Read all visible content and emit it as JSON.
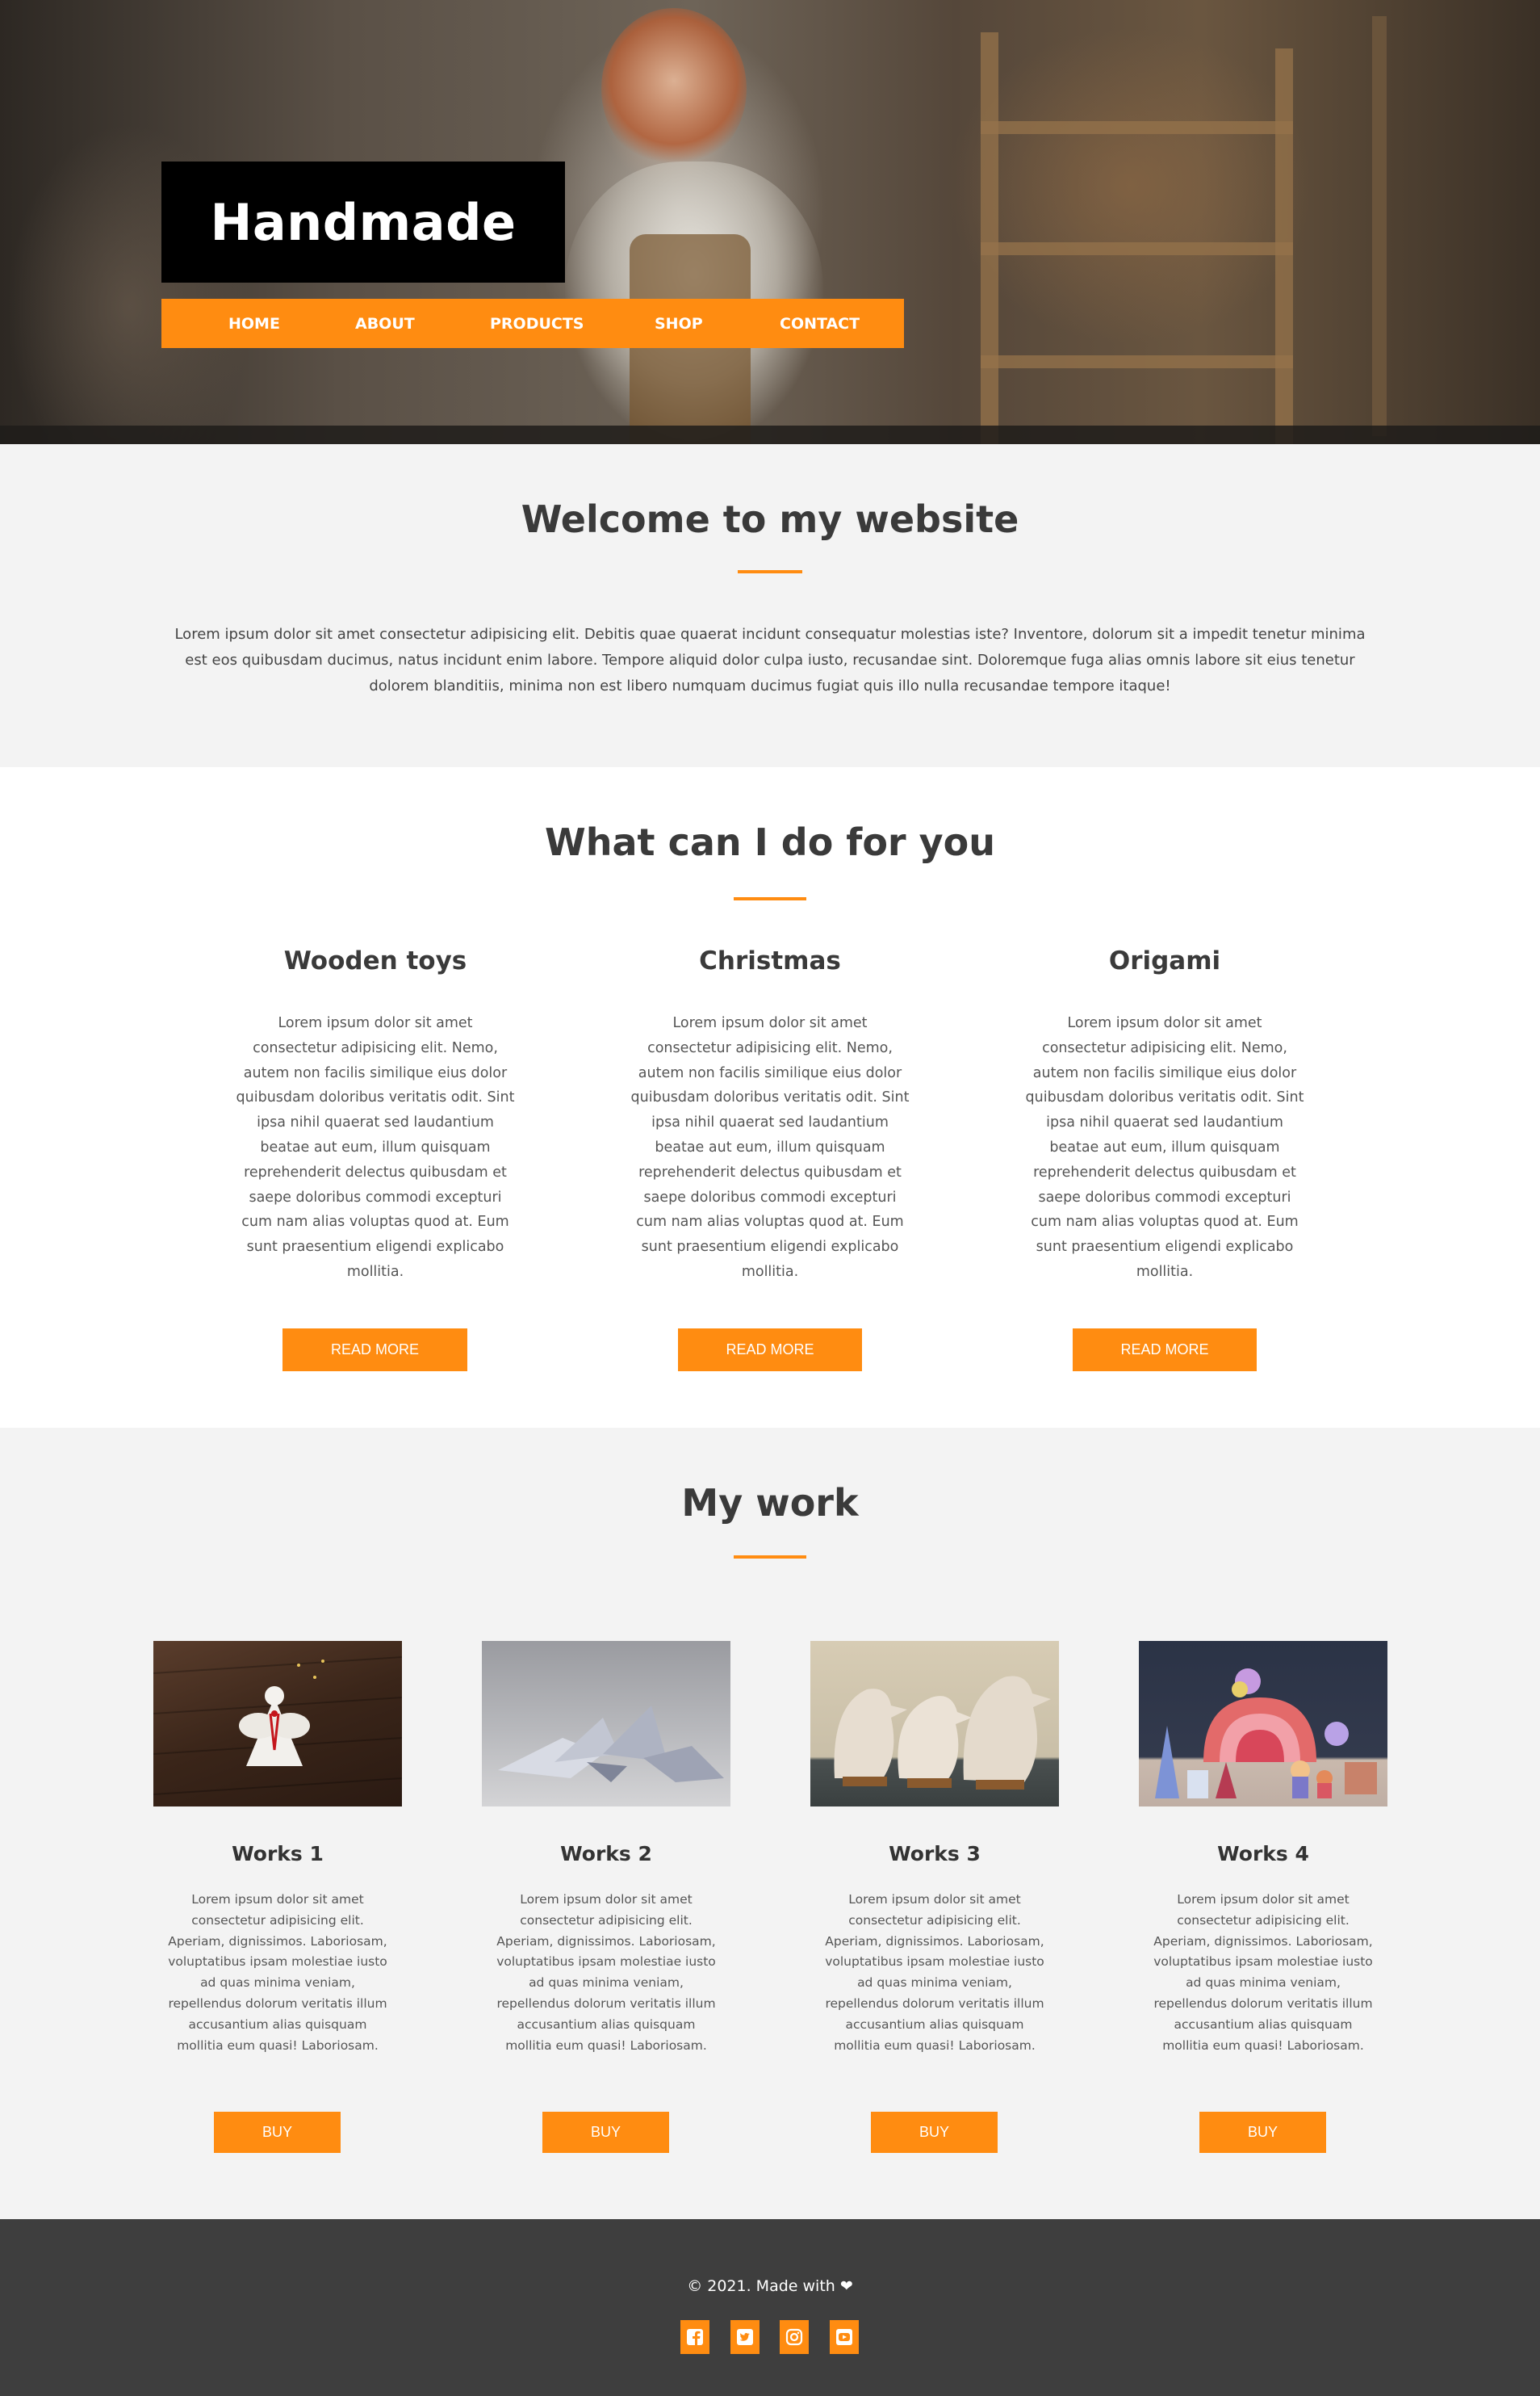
{
  "header": {
    "brand": "Handmade",
    "nav": [
      "HOME",
      "ABOUT",
      "PRODUCTS",
      "SHOP",
      "CONTACT"
    ]
  },
  "welcome": {
    "title": "Welcome to my website",
    "text": "Lorem ipsum dolor sit amet consectetur adipisicing elit. Debitis quae quaerat incidunt consequatur molestias iste? Inventore, dolorum sit a impedit tenetur minima est eos quibusdam ducimus, natus incidunt enim labore. Tempore aliquid dolor culpa iusto, recusandae sint. Doloremque fuga alias omnis labore sit eius tenetur dolorem blanditiis, minima non est libero numquam ducimus fugiat quis illo nulla recusandae tempore itaque!"
  },
  "services": {
    "title": "What can I do for you",
    "items": [
      {
        "title": "Wooden toys",
        "text": "Lorem ipsum dolor sit amet consectetur adipisicing elit. Nemo, autem non facilis similique eius dolor quibusdam doloribus veritatis odit. Sint ipsa nihil quaerat sed laudantium beatae aut eum, illum quisquam reprehenderit delectus quibusdam et saepe doloribus commodi excepturi cum nam alias voluptas quod at. Eum sunt praesentium eligendi explicabo mollitia.",
        "button": "READ MORE"
      },
      {
        "title": "Christmas",
        "text": "Lorem ipsum dolor sit amet consectetur adipisicing elit. Nemo, autem non facilis similique eius dolor quibusdam doloribus veritatis odit. Sint ipsa nihil quaerat sed laudantium beatae aut eum, illum quisquam reprehenderit delectus quibusdam et saepe doloribus commodi excepturi cum nam alias voluptas quod at. Eum sunt praesentium eligendi explicabo mollitia.",
        "button": "READ MORE"
      },
      {
        "title": "Origami",
        "text": "Lorem ipsum dolor sit amet consectetur adipisicing elit. Nemo, autem non facilis similique eius dolor quibusdam doloribus veritatis odit. Sint ipsa nihil quaerat sed laudantium beatae aut eum, illum quisquam reprehenderit delectus quibusdam et saepe doloribus commodi excepturi cum nam alias voluptas quod at. Eum sunt praesentium eligendi explicabo mollitia.",
        "button": "READ MORE"
      }
    ]
  },
  "work": {
    "title": "My work",
    "items": [
      {
        "title": "Works 1",
        "text": "Lorem ipsum dolor sit amet consectetur adipisicing elit. Aperiam, dignissimos. Laboriosam, voluptatibus ipsam molestiae iusto ad quas minima veniam, repellendus dolorum veritatis illum accusantium alias quisquam mollitia eum quasi! Laboriosam.",
        "button": "BUY"
      },
      {
        "title": "Works 2",
        "text": "Lorem ipsum dolor sit amet consectetur adipisicing elit. Aperiam, dignissimos. Laboriosam, voluptatibus ipsam molestiae iusto ad quas minima veniam, repellendus dolorum veritatis illum accusantium alias quisquam mollitia eum quasi! Laboriosam.",
        "button": "BUY"
      },
      {
        "title": "Works 3",
        "text": "Lorem ipsum dolor sit amet consectetur adipisicing elit. Aperiam, dignissimos. Laboriosam, voluptatibus ipsam molestiae iusto ad quas minima veniam, repellendus dolorum veritatis illum accusantium alias quisquam mollitia eum quasi! Laboriosam.",
        "button": "BUY"
      },
      {
        "title": "Works 4",
        "text": "Lorem ipsum dolor sit amet consectetur adipisicing elit. Aperiam, dignissimos. Laboriosam, voluptatibus ipsam molestiae iusto ad quas minima veniam, repellendus dolorum veritatis illum accusantium alias quisquam mollitia eum quasi! Laboriosam.",
        "button": "BUY"
      }
    ]
  },
  "footer": {
    "copyright": "© 2021. Made with ❤",
    "social": [
      "facebook-icon",
      "twitter-icon",
      "instagram-icon",
      "youtube-icon"
    ]
  },
  "colors": {
    "accent": "#ff8c11",
    "footer_bg": "#3e3e3e",
    "text": "#3a3a3a"
  }
}
